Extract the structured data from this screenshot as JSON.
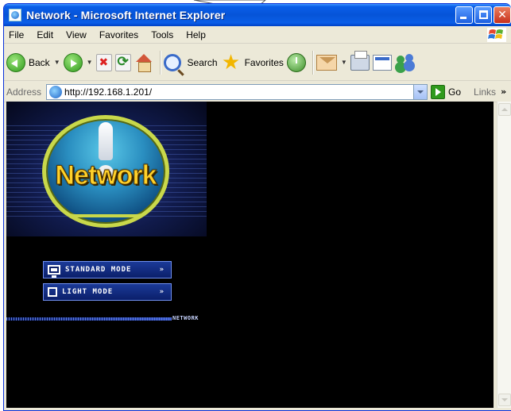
{
  "window": {
    "title": "Network - Microsoft Internet Explorer"
  },
  "menubar": {
    "items": [
      "File",
      "Edit",
      "View",
      "Favorites",
      "Tools",
      "Help"
    ]
  },
  "toolbar": {
    "back_label": "Back",
    "search_label": "Search",
    "favorites_label": "Favorites"
  },
  "addressbar": {
    "label": "Address",
    "url": "http://192.168.1.201/",
    "go_label": "Go",
    "links_label": "Links",
    "links_chevron": "»"
  },
  "page": {
    "logo_text": "Network",
    "standard_mode_label": "STANDARD MODE",
    "light_mode_label": "LIGHT MODE",
    "mode_arrows": "»",
    "strip_label": "NETWORK"
  },
  "colors": {
    "titlebar": "#0654d8",
    "chrome": "#ece9d8",
    "content_bg": "#000000",
    "mode_button": "#1b3a98",
    "logo_yellow": "#ffd22a"
  },
  "icons": {
    "back": "back-arrow-icon",
    "forward": "forward-arrow-icon",
    "stop": "stop-icon",
    "refresh": "refresh-icon",
    "home": "home-icon",
    "search": "search-icon",
    "favorites": "favorites-star-icon",
    "history": "history-icon",
    "mail": "mail-icon",
    "print": "print-icon",
    "edit": "edit-icon",
    "messenger": "messenger-icon"
  }
}
